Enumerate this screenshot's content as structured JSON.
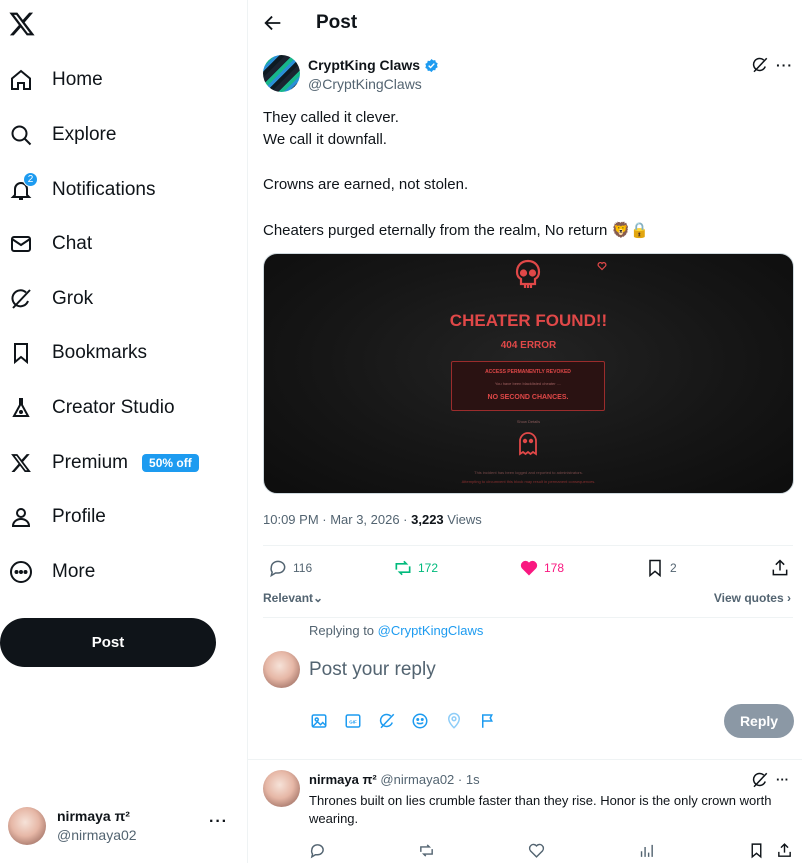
{
  "sidebar": {
    "items": [
      {
        "label": "Home",
        "icon": "home-icon"
      },
      {
        "label": "Explore",
        "icon": "search-icon"
      },
      {
        "label": "Notifications",
        "icon": "bell-icon",
        "badge": "2"
      },
      {
        "label": "Chat",
        "icon": "mail-icon"
      },
      {
        "label": "Grok",
        "icon": "grok-icon"
      },
      {
        "label": "Bookmarks",
        "icon": "bookmark-icon"
      },
      {
        "label": "Creator Studio",
        "icon": "flask-icon"
      },
      {
        "label": "Premium",
        "icon": "x-logo-icon",
        "promo": "50% off"
      },
      {
        "label": "Profile",
        "icon": "person-icon"
      },
      {
        "label": "More",
        "icon": "more-circle-icon"
      }
    ],
    "post_button": "Post",
    "account": {
      "name": "nirmaya π²",
      "handle": "@nirmaya02"
    }
  },
  "header": {
    "title": "Post"
  },
  "post": {
    "author_name": "CryptKing Claws",
    "author_handle": "@CryptKingClaws",
    "lines": [
      "They called it clever.",
      "We call it downfall.",
      "Crowns are earned, not stolen.",
      "Cheaters purged eternally from the realm, No return 🦁🔒"
    ],
    "media": {
      "title": "CHEATER FOUND!!",
      "subtitle": "404 ERROR",
      "box_line1": "ACCESS PERMANENTLY REVOKED",
      "box_line2": "You have been blacklisted cheater ....",
      "box_line3": "NO SECOND CHANCES.",
      "show_details": "Show Details",
      "footer1": "This incident has been logged and reported to administrators.",
      "footer2": "Attempting to circumvent this block may result in permanent consequences."
    },
    "time": "10:09 PM · Mar 3, 2026 · ",
    "views_count": "3,223",
    "views_label": " Views",
    "stats": {
      "replies": "116",
      "reposts": "172",
      "likes": "178",
      "bookmarks": "2"
    }
  },
  "sort": {
    "label": "Relevant",
    "view_quotes": "View quotes"
  },
  "reply": {
    "replying_to": "Replying to ",
    "replying_handle": "@CryptKingClaws",
    "placeholder": "Post your reply",
    "button": "Reply"
  },
  "comment": {
    "name": "nirmaya π²",
    "handle": "@nirmaya02",
    "time": "· 1s",
    "text": "Thrones built on lies crumble faster than they rise. Honor is the only crown worth wearing."
  },
  "colors": {
    "accent": "#1d9bf0",
    "repost": "#00ba7c",
    "like": "#f91880",
    "text": "#0f1419",
    "muted": "#536471"
  }
}
